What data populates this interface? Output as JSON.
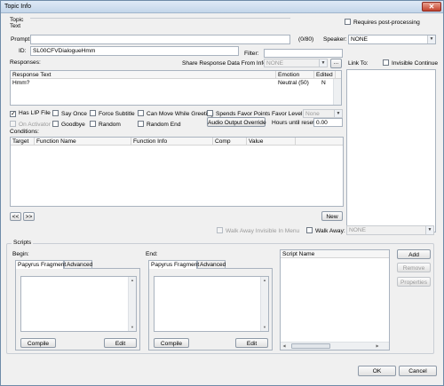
{
  "window": {
    "title": "Topic Info"
  },
  "topic_text": {
    "label": "Topic\nText",
    "value": ""
  },
  "requires_post_processing": {
    "label": "Requires post-processing",
    "checked": false
  },
  "prompt": {
    "label": "Prompt:",
    "value": "",
    "counter": "(0/80)"
  },
  "speaker": {
    "label": "Speaker:",
    "value": "NONE"
  },
  "id_field": {
    "label": "ID:",
    "value": "SL00CFVDialogueHmm"
  },
  "filter": {
    "label": "Filter:",
    "value": ""
  },
  "link_to": {
    "label": "Link To:"
  },
  "invisible_continue": {
    "label": "Invisible Continue",
    "checked": false
  },
  "responses": {
    "label": "Responses:",
    "share_label": "Share Response Data From Info:",
    "share_value": "NONE",
    "ellipsis": "...",
    "columns": [
      "Response Text",
      "Emotion",
      "Edited"
    ],
    "rows": [
      {
        "text": "Hmm?",
        "emotion": "Neutral (50)",
        "edited": "N"
      }
    ]
  },
  "flags": {
    "has_lip_file": {
      "label": "Has LIP File",
      "checked": true
    },
    "say_once": {
      "label": "Say Once",
      "checked": false
    },
    "force_subtitle": {
      "label": "Force Subtitle",
      "checked": false
    },
    "can_move_while_greeting": {
      "label": "Can Move While Greeting",
      "checked": false
    },
    "spends_favor_points": {
      "label": "Spends Favor Points",
      "checked": false
    },
    "on_activator": {
      "label": "On Activator",
      "checked": false
    },
    "goodbye": {
      "label": "Goodbye",
      "checked": false
    },
    "random": {
      "label": "Random",
      "checked": false
    },
    "random_end": {
      "label": "Random End",
      "checked": false
    }
  },
  "favor_level": {
    "label": "Favor Level:",
    "value": "None"
  },
  "audio_output_override": "Audio Output Override",
  "hours_until_reset": {
    "label": "Hours until reset:",
    "value": "0.00"
  },
  "conditions": {
    "label": "Conditions:",
    "columns": [
      "Target",
      "Function Name",
      "Function Info",
      "Comp",
      "Value"
    ],
    "rows": []
  },
  "nav": {
    "prev": "<<",
    "next": ">>"
  },
  "new_button": "New",
  "walk_away_invisible": {
    "label": "Walk Away Invisible In Menu",
    "checked": false
  },
  "walk_away": {
    "label": "Walk Away:",
    "value": "NONE",
    "checked": false
  },
  "scripts": {
    "label": "Scripts",
    "begin_label": "Begin:",
    "end_label": "End:",
    "tabs": [
      "Papyrus Fragment",
      "Advanced"
    ],
    "compile": "Compile",
    "edit": "Edit",
    "script_name_header": "Script Name",
    "add": "Add",
    "remove": "Remove",
    "properties": "Properties"
  },
  "ok": "OK",
  "cancel": "Cancel"
}
